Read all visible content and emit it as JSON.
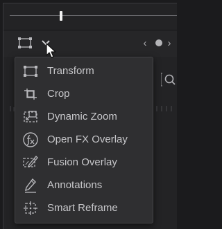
{
  "toolbar": {
    "prev_label": "‹",
    "next_label": "›"
  },
  "menu": {
    "items": [
      {
        "label": "Transform",
        "icon": "transform-icon"
      },
      {
        "label": "Crop",
        "icon": "crop-icon"
      },
      {
        "label": "Dynamic Zoom",
        "icon": "dynamic-zoom-icon"
      },
      {
        "label": "Open FX Overlay",
        "icon": "open-fx-overlay-icon"
      },
      {
        "label": "Fusion Overlay",
        "icon": "fusion-overlay-icon"
      },
      {
        "label": "Annotations",
        "icon": "annotations-icon"
      },
      {
        "label": "Smart Reframe",
        "icon": "smart-reframe-icon"
      }
    ]
  },
  "colors": {
    "menu_bg": "#2f2f31",
    "menu_text": "#c7c7ca",
    "icon": "#b9b9bd",
    "background": "#232325"
  }
}
